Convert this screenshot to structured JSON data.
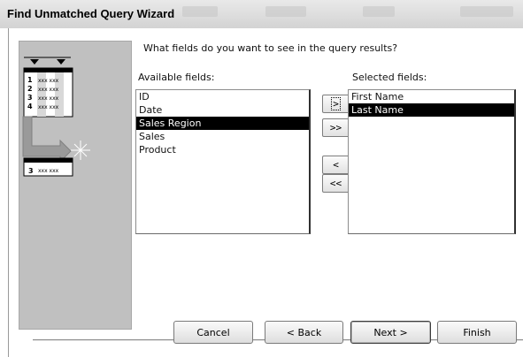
{
  "window": {
    "title": "Find Unmatched Query Wizard"
  },
  "prompt": "What fields do you want to see in the query results?",
  "available": {
    "label": "Available fields:",
    "items": [
      "ID",
      "Date",
      "Sales Region",
      "Sales",
      "Product"
    ],
    "selected_index": 2
  },
  "selected": {
    "label": "Selected fields:",
    "items": [
      "First Name",
      "Last Name"
    ],
    "selected_index": 1
  },
  "move": {
    "add_one": ">",
    "add_all": ">>",
    "remove_one": "<",
    "remove_all": "<<"
  },
  "buttons": {
    "cancel": "Cancel",
    "back": "< Back",
    "next": "Next >",
    "finish": "Finish"
  },
  "illustration": {
    "row_numbers": [
      "1",
      "2",
      "3",
      "4"
    ],
    "cell_text": "xxx xxx",
    "result_number": "3"
  },
  "colors": {
    "selection_bg": "#000000",
    "panel_bg": "#c0c0c0"
  }
}
